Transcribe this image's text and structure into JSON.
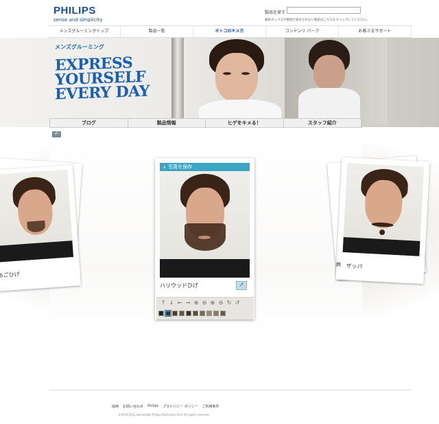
{
  "header": {
    "brand": "PHILIPS",
    "tagline": "sense and simplicity",
    "search_label": "製品を探す",
    "search_placeholder": "",
    "search_note": "検索ボックスが接続が表示されない場合はこちらをクリックしてください。"
  },
  "topnav": [
    "メンズグルーミングトップ",
    "製品一覧",
    "オトコのキメ方",
    "コンテンツ パーク",
    "お客さまサポート"
  ],
  "hero": {
    "subtitle": "メンズグルーミング",
    "title_lines": [
      "EXPRESS",
      "YOURSELF",
      "EVERY DAY"
    ]
  },
  "subnav": [
    "ブログ",
    "製品情報",
    "ヒゲをキメる！",
    "スタッフ紹介"
  ],
  "back_icon": "↶",
  "left_card": {
    "caption": "あごひげ"
  },
  "right_card": {
    "caption": "ザッパ",
    "side_caption": "麻"
  },
  "center_card": {
    "save_label": "写真を保存",
    "caption": "ハリウッドひげ",
    "share_icon": "➚"
  },
  "tools": [
    "↑",
    "↓",
    "←",
    "→",
    "⊕",
    "⊖",
    "⊕",
    "⊖",
    "↻",
    "↺"
  ],
  "swatches": [
    "#2a2420",
    "#1f3a40",
    "#4a3b2c",
    "#6b5238",
    "#3a3026",
    "#5a4a3a",
    "#7a6a55",
    "#9a8a6e",
    "#8c7a5f",
    "#6e5a42"
  ],
  "footer": {
    "links": [
      "採用",
      "お問い合わせ",
      "Philips",
      "プライバシー ポリシー",
      "ご利用条件"
    ],
    "copyright": "©2010-2011 Koninklijke Philips Electronics N.V. All rights reserved."
  }
}
